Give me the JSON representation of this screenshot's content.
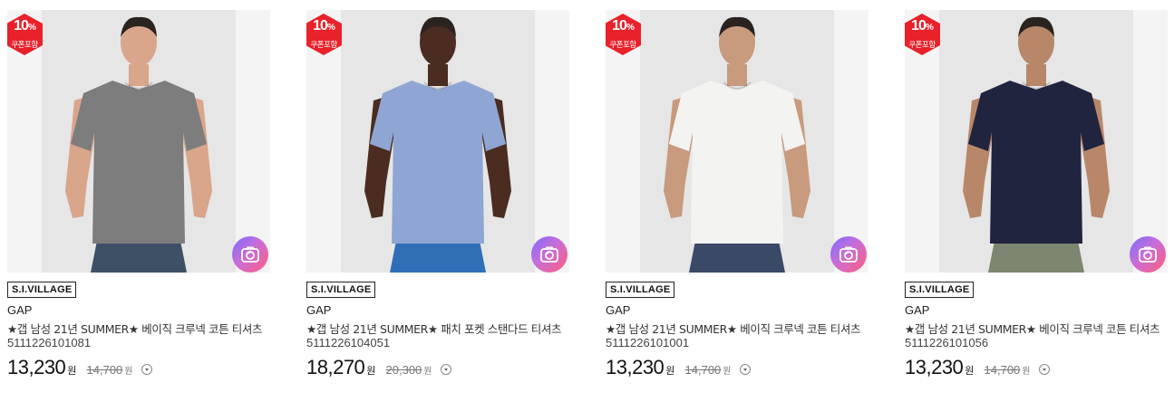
{
  "products": [
    {
      "badge_pct": "10",
      "badge_unit": "%",
      "badge_text": "쿠폰포함",
      "tag": "S.I.VILLAGE",
      "brand": "GAP",
      "name": "★갭 남성 21년 SUMMER★ 베이직 크루넥 코튼 티셔츠",
      "code": "5111226101081",
      "price": "13,230",
      "price_unit": "원",
      "original_price": "14,700",
      "original_unit": "원",
      "shirt_color": "#7d7d7d",
      "pants_color": "#3d5066",
      "skin_color": "#d9a58b"
    },
    {
      "badge_pct": "10",
      "badge_unit": "%",
      "badge_text": "쿠폰포함",
      "tag": "S.I.VILLAGE",
      "brand": "GAP",
      "name": "★갭 남성 21년 SUMMER★ 패치 포켓 스탠다드 티셔츠",
      "code": "5111226104051",
      "price": "18,270",
      "price_unit": "원",
      "original_price": "20,300",
      "original_unit": "원",
      "shirt_color": "#8fa6d4",
      "pants_color": "#2f6fb6",
      "skin_color": "#4a2c20"
    },
    {
      "badge_pct": "10",
      "badge_unit": "%",
      "badge_text": "쿠폰포함",
      "tag": "S.I.VILLAGE",
      "brand": "GAP",
      "name": "★갭 남성 21년 SUMMER★ 베이직 크루넥 코튼 티셔츠",
      "code": "5111226101001",
      "price": "13,230",
      "price_unit": "원",
      "original_price": "14,700",
      "original_unit": "원",
      "shirt_color": "#f3f3f1",
      "pants_color": "#3a4a66",
      "skin_color": "#c89a7e"
    },
    {
      "badge_pct": "10",
      "badge_unit": "%",
      "badge_text": "쿠폰포함",
      "tag": "S.I.VILLAGE",
      "brand": "GAP",
      "name": "★갭 남성 21년 SUMMER★ 베이직 크루넥 코튼 티셔츠",
      "code": "5111226101056",
      "price": "13,230",
      "price_unit": "원",
      "original_price": "14,700",
      "original_unit": "원",
      "shirt_color": "#20243f",
      "pants_color": "#7c8670",
      "skin_color": "#b8876a"
    }
  ],
  "colors": {
    "badge_red": "#e8212a",
    "camera_gradient": [
      "#7b6cff",
      "#c86dd7",
      "#ff5f7e"
    ]
  },
  "icons": {
    "badge": "coupon-badge-icon",
    "camera": "camera-search-icon",
    "info": "chevron-circle-icon"
  }
}
